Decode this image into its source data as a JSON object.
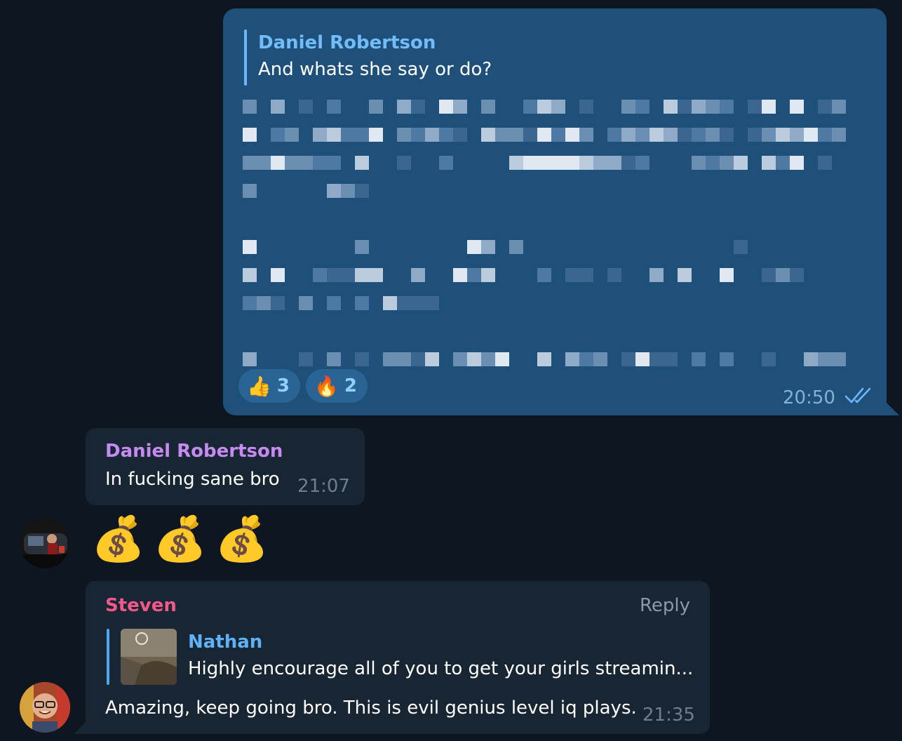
{
  "outgoing_message": {
    "reply_to": {
      "name": "Daniel Robertson",
      "text": "And whats she say or do?"
    },
    "body": "",
    "reactions": [
      {
        "emoji": "👍",
        "count": "3"
      },
      {
        "emoji": "🔥",
        "count": "2"
      }
    ],
    "time": "20:50",
    "status_icon": "double-check-icon"
  },
  "incoming_message_1": {
    "sender": "Daniel Robertson",
    "text": "In fucking sane bro",
    "time": "21:07"
  },
  "emoji_message": {
    "emojis": [
      "💰",
      "💰",
      "💰"
    ]
  },
  "incoming_message_2": {
    "sender": "Steven",
    "reply_button": "Reply",
    "reply_to": {
      "name": "Nathan",
      "text": "Highly encourage all of you to get your girls streamin..."
    },
    "text": "Amazing, keep going bro. This is evil genius level iq plays.",
    "time": "21:35"
  },
  "colors": {
    "background": "#0e1621",
    "outgoing_bubble": "#1e5079",
    "incoming_bubble": "#182533",
    "name_purple": "#c68bf0",
    "name_pink": "#f2598a",
    "accent_blue": "#72bdf9"
  }
}
